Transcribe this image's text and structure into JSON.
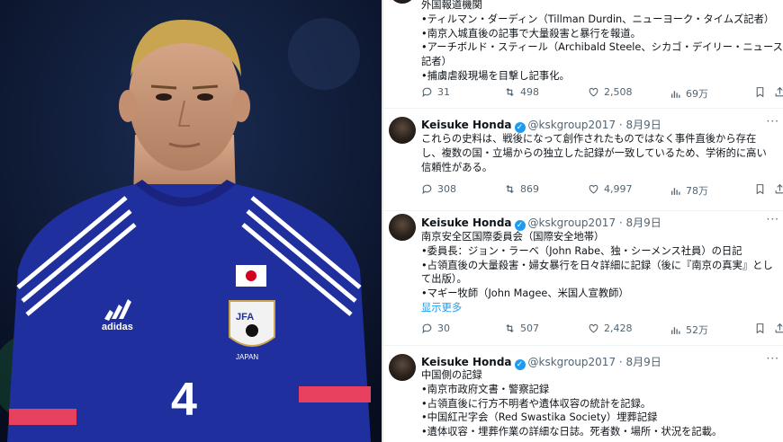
{
  "tweets": [
    {
      "author_name": "",
      "handle": "",
      "date": "",
      "lines": [
        "外国報道機関",
        "•ティルマン・ダーディン（Tillman Durdin、ニューヨーク・タイムズ記者）",
        "•南京入城直後の記事で大量殺害と暴行を報道。",
        "•アーチボルド・スティール（Archibald Steele、シカゴ・デイリー・ニュース",
        "記者）",
        "•捕虜虐殺現場を目撃し記事化。"
      ],
      "show_more": "",
      "replies": "31",
      "retweets": "498",
      "likes": "2,508",
      "views": "69万"
    },
    {
      "author_name": "Keisuke Honda",
      "handle": "@kskgroup2017",
      "date": "8月9日",
      "lines": [
        "これらの史料は、戦後になって創作されたものではなく事件直後から存在",
        "し、複数の国・立場からの独立した記録が一致しているため、学術的に高い",
        "信頼性がある。"
      ],
      "show_more": "",
      "replies": "308",
      "retweets": "869",
      "likes": "4,997",
      "views": "78万"
    },
    {
      "author_name": "Keisuke Honda",
      "handle": "@kskgroup2017",
      "date": "8月9日",
      "lines": [
        "南京安全区国際委員会（国際安全地帯）",
        "•委員長：ジョン・ラーベ（John Rabe、独・シーメンス社員）の日記",
        "•占領直後の大量殺害・婦女暴行を日々詳細に記録（後に『南京の真実』とし",
        "て出版）。",
        "•マギー牧師（John Magee、米国人宣教師）"
      ],
      "show_more": "显示更多",
      "replies": "30",
      "retweets": "507",
      "likes": "2,428",
      "views": "52万"
    },
    {
      "author_name": "Keisuke Honda",
      "handle": "@kskgroup2017",
      "date": "8月9日",
      "lines": [
        "中国側の記録",
        "•南京市政府文書・警察記録",
        "•占領直後に行方不明者や遺体収容の統計を記録。",
        "•中国紅卍字会（Red Swastika Society）埋葬記録",
        "•遺体収容・埋葬作業の詳細な日誌。死者数・場所・状況を記載。"
      ],
      "show_more": "",
      "replies": "",
      "retweets": "",
      "likes": "",
      "views": ""
    }
  ],
  "photo": {
    "jersey_number": "4",
    "sleeve_brand": "adidas",
    "crest_letters": "JFA",
    "crest_caption": "JAPAN"
  },
  "colors": {
    "jersey": "#1f2f9e",
    "accent": "#e8415f",
    "link": "#1d9bf0",
    "muted": "#536471"
  },
  "icons": [
    "reply-icon",
    "retweet-icon",
    "like-icon",
    "views-icon",
    "bookmark-icon",
    "share-icon",
    "verified-badge-icon",
    "more-icon"
  ]
}
